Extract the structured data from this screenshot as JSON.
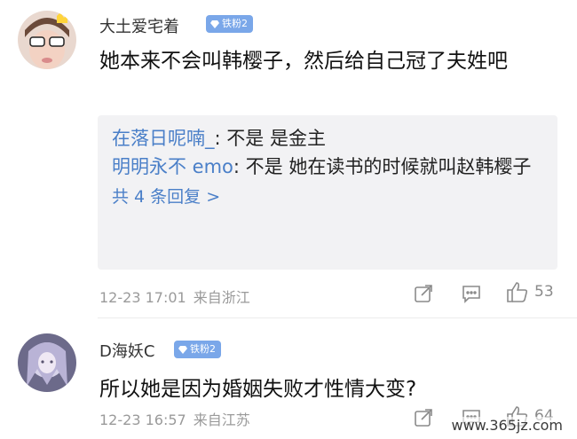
{
  "comments": [
    {
      "username": "大土爱宅着",
      "badge": "铁粉2",
      "content": "她本来不会叫韩樱子，然后给自己冠了夫姓吧",
      "replies": [
        {
          "name": "在落日呢喃_",
          "sep": ": ",
          "text": "不是 是金主"
        },
        {
          "name": "明明永不 emo",
          "sep": ": ",
          "text": "不是 她在读书的时候就叫赵韩樱子"
        }
      ],
      "replies_more": "共 4 条回复 >",
      "date": "12-23 17:01",
      "location": "来自浙江",
      "likes": "53"
    },
    {
      "username": "D海妖C",
      "badge": "铁粉2",
      "content": "所以她是因为婚姻失败才性情大变?",
      "date": "12-23 16:57",
      "location": "来自江苏",
      "likes": "64"
    }
  ],
  "watermark": "www.365jz.com",
  "colors": {
    "link": "#4a7fc8",
    "badge": "#7aa7e9",
    "meta": "#9a9a9a",
    "reply_bg": "#f2f2f4"
  }
}
